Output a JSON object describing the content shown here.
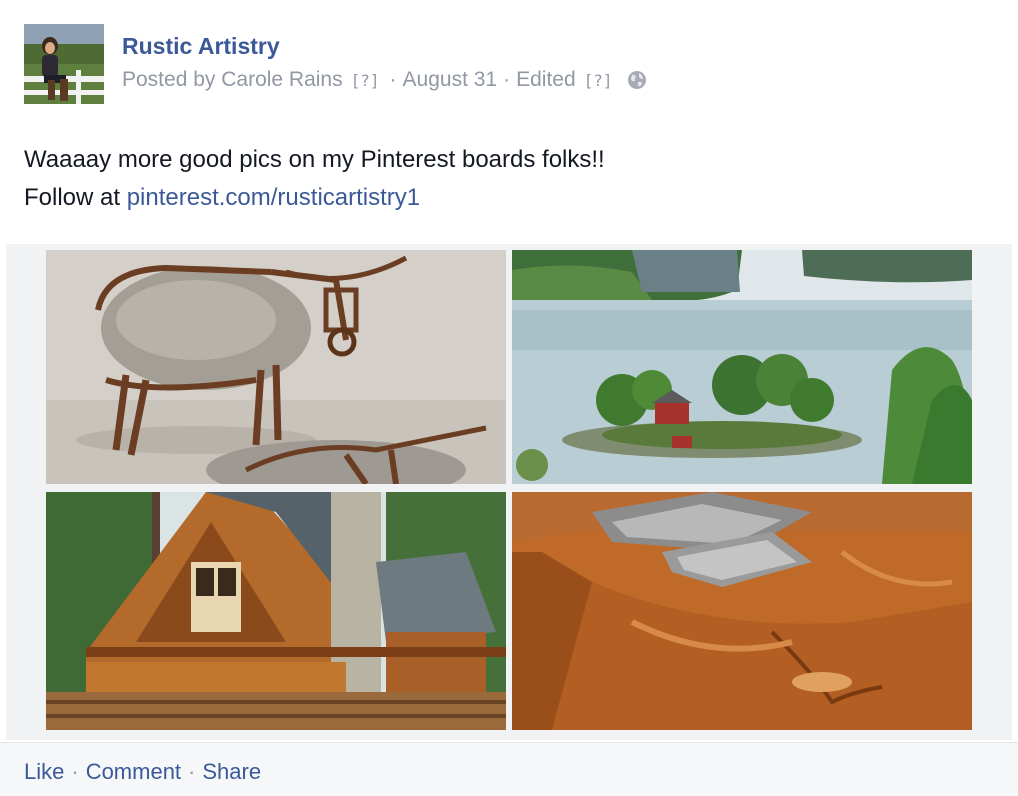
{
  "post": {
    "page_name": "Rustic Artistry",
    "posted_by": "Posted by Carole Rains",
    "help_marker": "[?]",
    "date": "August 31",
    "edited": "Edited",
    "separator": "·",
    "privacy_icon": "globe-icon",
    "message_line1": "Waaaay more good pics on my Pinterest boards folks!!",
    "message_line2_prefix": "Follow at ",
    "message_link": "pinterest.com/rusticartistry1"
  },
  "photos": [
    {
      "name": "photo-metal-bull-sculpture"
    },
    {
      "name": "photo-lake-island-cabin"
    },
    {
      "name": "photo-log-house"
    },
    {
      "name": "photo-wood-countertop-sink"
    }
  ],
  "actions": {
    "like": "Like",
    "comment": "Comment",
    "share": "Share",
    "separator": "·"
  },
  "colors": {
    "link_blue": "#3b5998",
    "meta_gray": "#9197a3",
    "footer_bg": "#f6f7f8"
  }
}
